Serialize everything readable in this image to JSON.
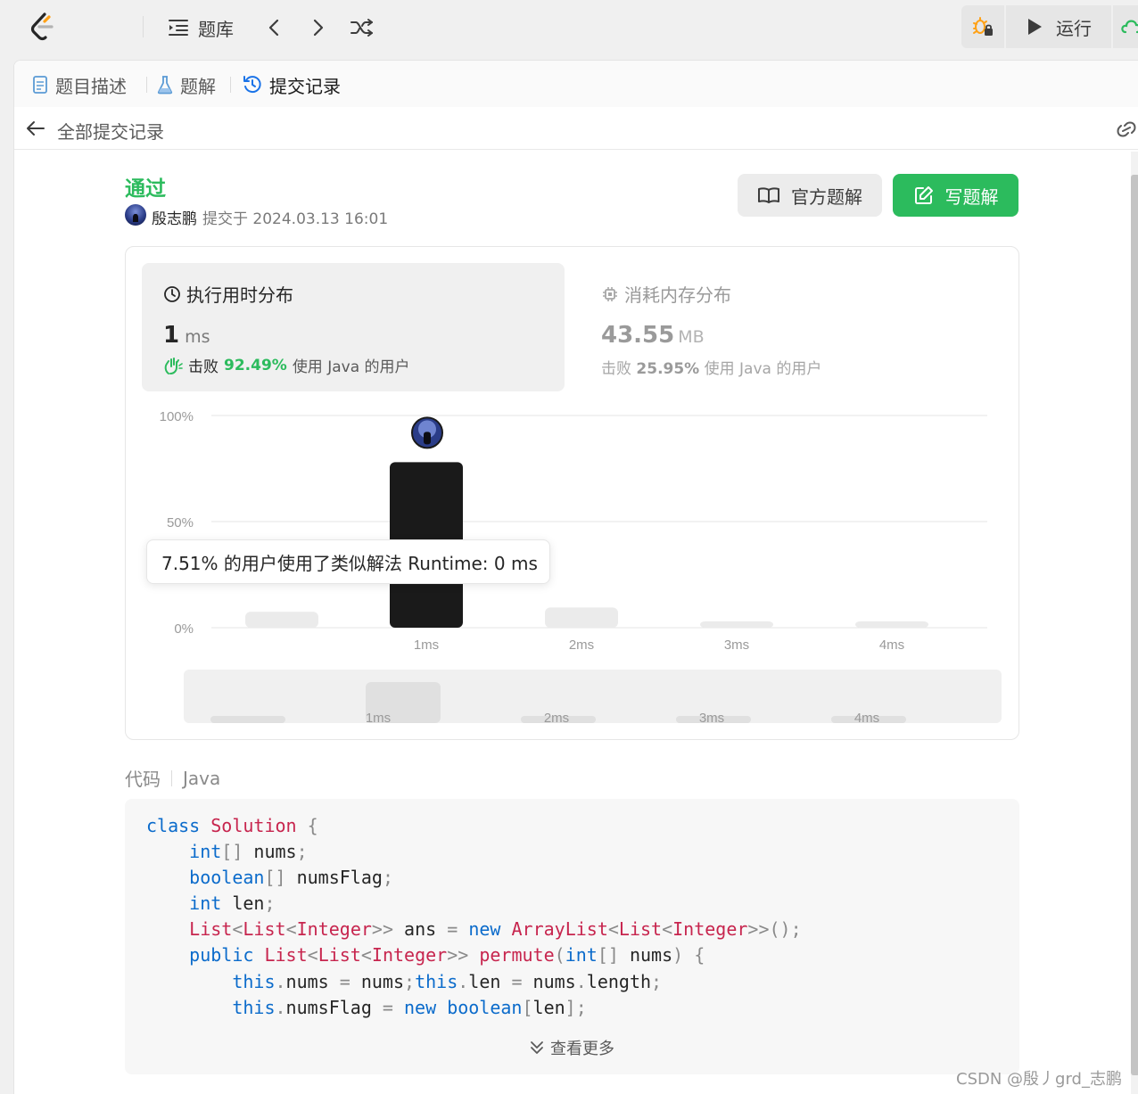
{
  "topbar": {
    "problemset_label": "题库",
    "run_label": "运行"
  },
  "tabs": [
    {
      "label": "题目描述"
    },
    {
      "label": "题解"
    },
    {
      "label": "提交记录"
    }
  ],
  "back_label": "全部提交记录",
  "submission": {
    "status": "通过",
    "user": "殷志鹏",
    "submitted_at": "提交于 2024.03.13 16:01",
    "official_solution_label": "官方题解",
    "write_solution_label": "写题解"
  },
  "runtime": {
    "title": "执行用时分布",
    "value": "1",
    "unit": "ms",
    "beat_prefix": "击败",
    "beat_pct": "92.49%",
    "beat_suffix": "使用 Java 的用户"
  },
  "memory": {
    "title": "消耗内存分布",
    "value": "43.55",
    "unit": "MB",
    "beat_prefix": "击败",
    "beat_pct": "25.95%",
    "beat_suffix": "使用 Java 的用户"
  },
  "chart_data": {
    "type": "bar",
    "categories": [
      "0ms",
      "1ms",
      "2ms",
      "3ms",
      "4ms"
    ],
    "x_tick_labels": [
      "",
      "1ms",
      "2ms",
      "3ms",
      "4ms"
    ],
    "values": [
      7.51,
      78.0,
      9.5,
      3.0,
      3.0
    ],
    "ylim": [
      0,
      100
    ],
    "y_tick_labels": [
      "100%",
      "50%",
      "0%"
    ],
    "y_ticks": [
      100,
      50,
      0
    ],
    "highlight_category": "1ms",
    "navigator_labels": [
      "1ms",
      "2ms",
      "3ms",
      "4ms"
    ],
    "tooltip": "7.51% 的用户使用了类似解法 Runtime: 0 ms",
    "colors": {
      "highlight": "#1a1a1a",
      "bar": "#ebebeb",
      "grid": "#e6e6e6",
      "navigator": "#f0f0f0",
      "navigator_bar": "#e0e0e0"
    }
  },
  "code": {
    "label": "代码",
    "language": "Java",
    "show_more": "查看更多"
  },
  "watermark": "CSDN @殷丿grd_志鹏"
}
